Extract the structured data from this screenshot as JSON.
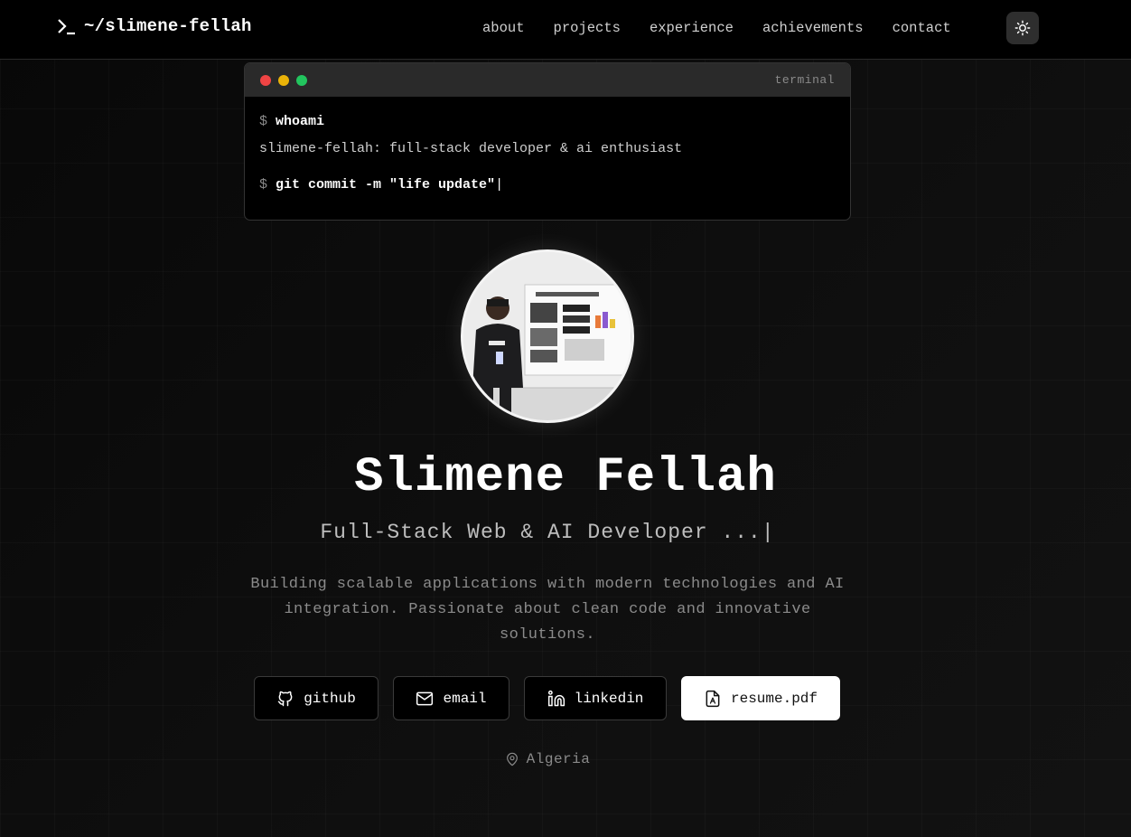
{
  "nav": {
    "brand": "~/slimene-fellah",
    "links": [
      "about",
      "projects",
      "experience",
      "achievements",
      "contact"
    ]
  },
  "terminal": {
    "title": "terminal",
    "prompt": "$",
    "cmd1": "whoami",
    "out1": "slimene-fellah: full-stack developer & ai enthusiast",
    "cmd2": "git commit -m \"life update\"",
    "cursor": "|"
  },
  "hero": {
    "name": "Slimene Fellah",
    "role": "Full-Stack Web & AI Developer ...|",
    "description": "Building scalable applications with modern technologies and AI integration. Passionate about clean code and innovative solutions."
  },
  "buttons": {
    "github": "github",
    "email": "email",
    "linkedin": "linkedin",
    "resume": "resume.pdf"
  },
  "location": "Algeria",
  "icons": {
    "brand": "terminal-prompt-icon",
    "theme": "sun-icon",
    "github": "github-icon",
    "email": "mail-icon",
    "linkedin": "linkedin-icon",
    "resume": "file-icon",
    "location": "map-pin-icon"
  },
  "colors": {
    "background": "#0a0a0a",
    "accent_dot_red": "#ef4444",
    "accent_dot_yellow": "#eab308",
    "accent_dot_green": "#22c55e"
  }
}
